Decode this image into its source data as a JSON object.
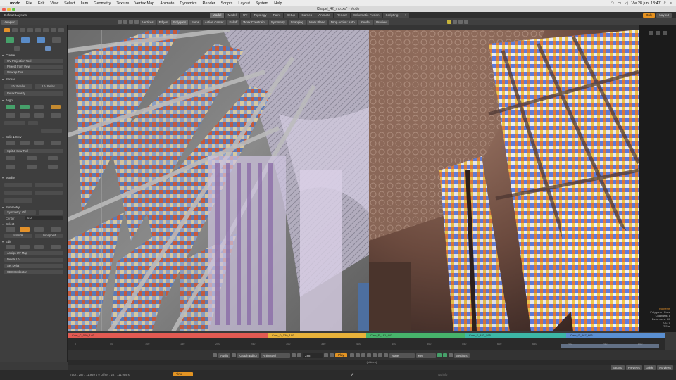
{
  "menubar": {
    "app": "modo",
    "items": [
      "File",
      "Edit",
      "View",
      "Select",
      "Item",
      "Geometry",
      "Texture",
      "Vertex Map",
      "Animate",
      "Dynamics",
      "Render",
      "Scripts",
      "Layout",
      "System",
      "Help"
    ],
    "clock": "Vie 28 jun. 13:47"
  },
  "window": {
    "title": "Chapel_42_mo.lxo* - Modo"
  },
  "layout": {
    "name": "Default Layouts",
    "tabs": [
      "Model",
      "Model",
      "UV",
      "Topology",
      "Paint",
      "Setup",
      "Games",
      "Animate",
      "Render",
      "Schematic Fusion",
      "Scripting"
    ],
    "active_tab": 0,
    "only_label": "Only",
    "layout_label": "Layout"
  },
  "toolbar": {
    "items": [
      "Vertices",
      "Edges",
      "Polygons",
      "Items",
      "Action Center",
      "Falloff",
      "Work Constraint",
      "Symmetry",
      "Snapping",
      "Work Plane",
      "Drop Action: Auto",
      "Render",
      "Preview"
    ]
  },
  "leftpanel": {
    "viewport_label": "Viewport",
    "sections": {
      "create": "Create",
      "create_items": [
        "UV Projection Tool",
        "Project from View",
        "Unwrap Tool"
      ],
      "spread": "Spread",
      "spread_items": [
        "UV Peeler",
        "UV Relax"
      ],
      "relax": "Relax Density",
      "align": "Align",
      "split": "Split & Sew",
      "split_items": [
        "Split & Sew Tool"
      ],
      "modify": "Modify",
      "symmetry": "Symmetry",
      "symmetry_value": "Symmetry: Off",
      "center_label": "Center",
      "center_value": "0.0",
      "select": "Select",
      "select_items": [
        "Islands",
        "Unmapped"
      ],
      "edit": "Edit",
      "edit_items": [
        "Assign UV Map",
        "Delete UV",
        "Set Delta",
        "UDIM Indicator"
      ]
    }
  },
  "viewport": {
    "stats": [
      "No Items",
      "Polygons : Face",
      "Channels: 8",
      "Deformers: Off",
      "GL: 0",
      "2.5 m"
    ]
  },
  "timeline": {
    "scenes": [
      {
        "label": "Cam_C_000_140",
        "color": "#e25a52"
      },
      {
        "label": "Cam_D_130_180",
        "color": "#e8b23a"
      },
      {
        "label": "Cam_E_181_442",
        "color": "#46b36b"
      },
      {
        "label": "Cam_F_443_595",
        "color": "#3cb6a6"
      },
      {
        "label": "Cam_G_567_663",
        "color": "#5a8fd1"
      }
    ],
    "ticks": [
      "0",
      "50",
      "100",
      "150",
      "200",
      "250",
      "300",
      "350",
      "400",
      "450",
      "500",
      "550",
      "600",
      "650",
      "700",
      "750",
      "800"
    ],
    "transport": {
      "audio": "Audio",
      "graph_editor": "Graph Editor",
      "mode": "Animated",
      "frame": "288",
      "play": "Play",
      "keys_none": "None",
      "key_label": "Key",
      "settings": "Settings"
    },
    "status": "(hidden)",
    "bottom": {
      "left_label": "",
      "right_items": [
        "Backup",
        "Previews",
        "Guide",
        "No views"
      ]
    }
  },
  "footer": {
    "track_text": "Track : 287 , 11.959 s  ● Offset : 287 , 11.959 s",
    "time_button": "Time",
    "right_text": "No info"
  }
}
